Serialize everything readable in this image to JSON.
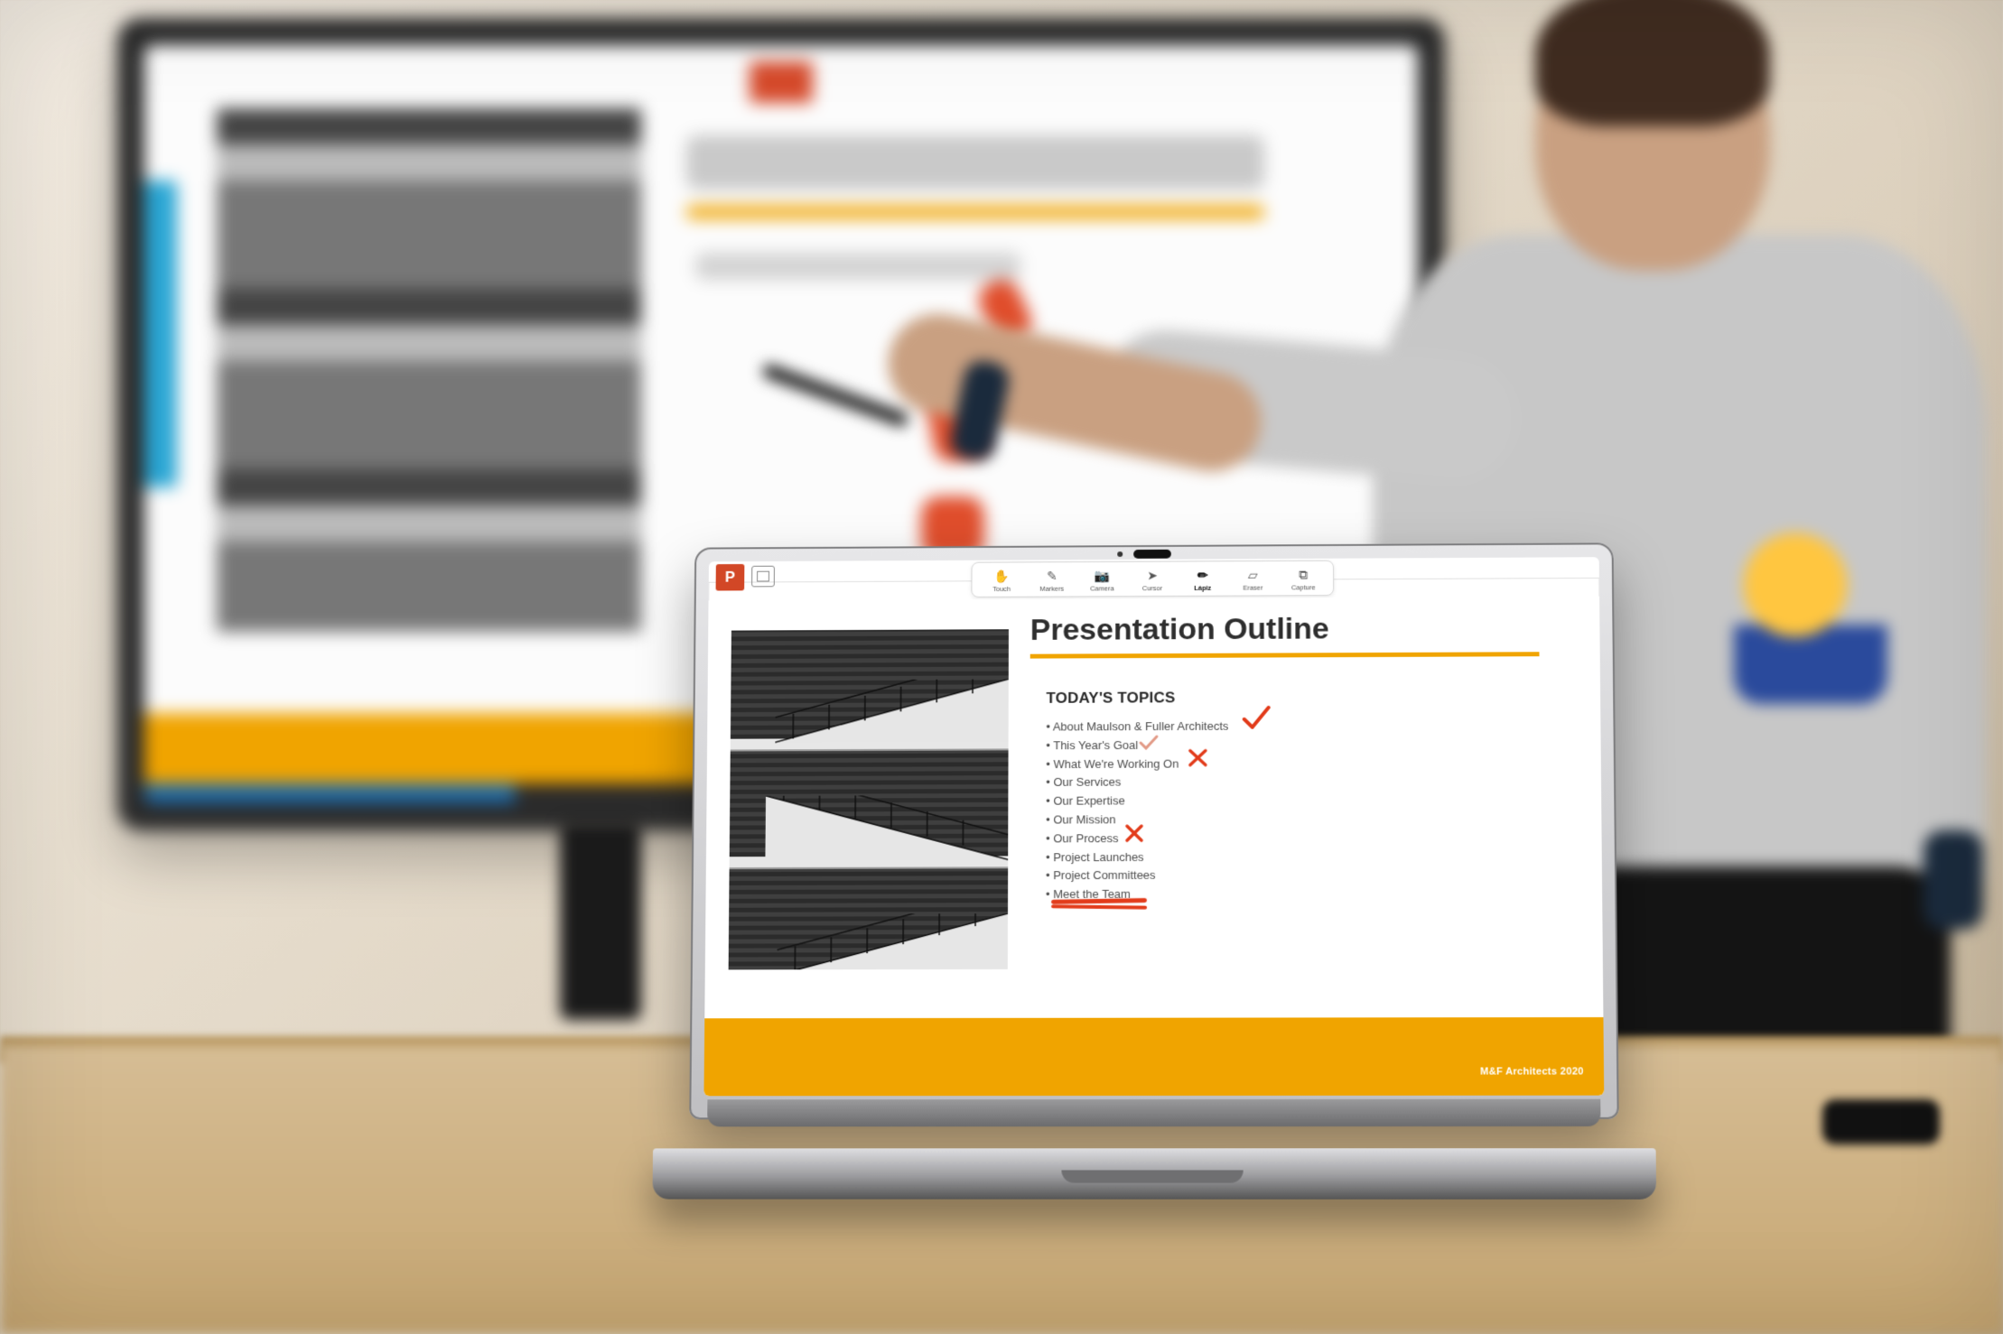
{
  "app": {
    "name": "P"
  },
  "toolbar": {
    "items": [
      {
        "label": "Touch"
      },
      {
        "label": "Markers"
      },
      {
        "label": "Camera"
      },
      {
        "label": "Cursor"
      },
      {
        "label": "Lápiz"
      },
      {
        "label": "Eraser"
      },
      {
        "label": "Capture"
      }
    ],
    "active_index": 4
  },
  "slide": {
    "title": "Presentation Outline",
    "subhead": "TODAY'S TOPICS",
    "topics": [
      "About Maulson & Fuller Architects",
      "This Year's Goal",
      "What We're Working On",
      "Our Services",
      "Our Expertise",
      "Our Mission",
      "Our Process",
      "Project Launches",
      "Project Committees",
      "Meet the Team"
    ],
    "footer": "M&F Architects 2020"
  },
  "annotations": {
    "check_items": [
      0
    ],
    "small_check_items": [
      1
    ],
    "x_items": [
      2,
      6
    ],
    "underline_items": [
      9
    ]
  },
  "colors": {
    "accent": "#f0a400",
    "brand": "#d24726",
    "pen": "#e23b1a"
  }
}
